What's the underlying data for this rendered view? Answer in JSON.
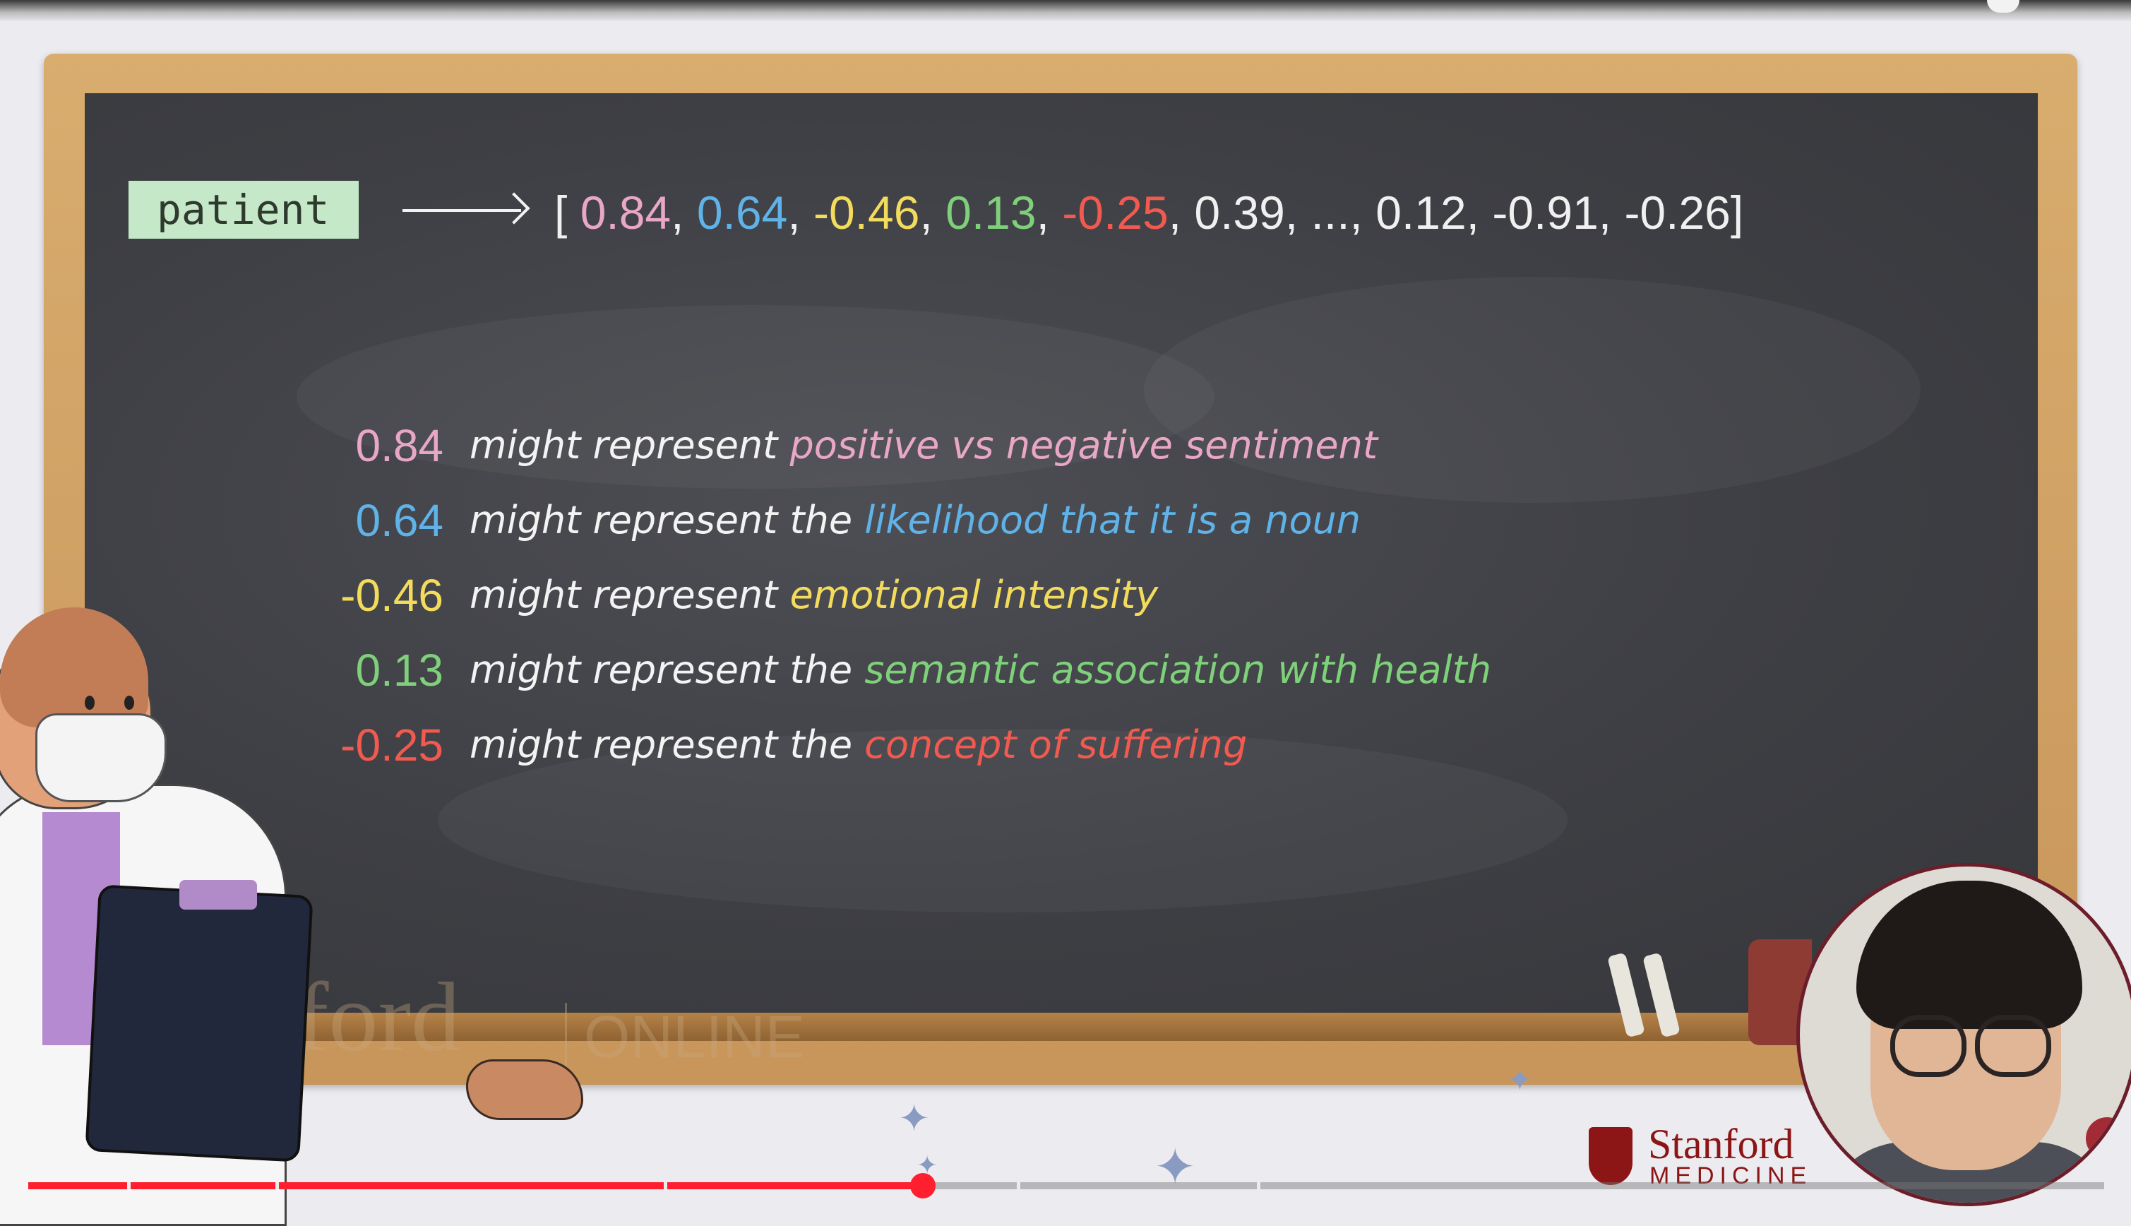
{
  "slide": {
    "token": "patient",
    "vector": [
      {
        "text": "[ ",
        "color": "#f0f0f0"
      },
      {
        "text": "0.84",
        "color": "#e9a7c6"
      },
      {
        "text": ", ",
        "color": "#f0f0f0"
      },
      {
        "text": "0.64",
        "color": "#5fb3e8"
      },
      {
        "text": ", ",
        "color": "#f0f0f0"
      },
      {
        "text": "-0.46",
        "color": "#f3dc5c"
      },
      {
        "text": ", ",
        "color": "#f0f0f0"
      },
      {
        "text": "0.13",
        "color": "#7fd07a"
      },
      {
        "text": ", ",
        "color": "#f0f0f0"
      },
      {
        "text": "-0.25",
        "color": "#f25a4f"
      },
      {
        "text": ", 0.39, ..., 0.12, -0.91, -0.26]",
        "color": "#f0f0f0"
      }
    ],
    "rows": [
      {
        "value": "0.84",
        "prefix": "might represent ",
        "meaning": "positive vs negative sentiment",
        "color": "#e9a7c6"
      },
      {
        "value": "0.64",
        "prefix": "might represent the ",
        "meaning": "likelihood that it is a noun",
        "color": "#5fb3e8"
      },
      {
        "value": "-0.46",
        "prefix": "might represent ",
        "meaning": "emotional intensity",
        "color": "#f3dc5c"
      },
      {
        "value": "0.13",
        "prefix": "might represent the ",
        "meaning": "semantic association with health",
        "color": "#7fd07a"
      },
      {
        "value": "-0.25",
        "prefix": "might represent the ",
        "meaning": "concept of suffering",
        "color": "#f25a4f"
      }
    ],
    "watermark": {
      "name": "Stanford",
      "sub": "ONLINE"
    }
  },
  "logo": {
    "name": "Stanford",
    "sub": "MEDICINE"
  },
  "player": {
    "progress": 0.431,
    "accent": "#ff1f2e"
  }
}
